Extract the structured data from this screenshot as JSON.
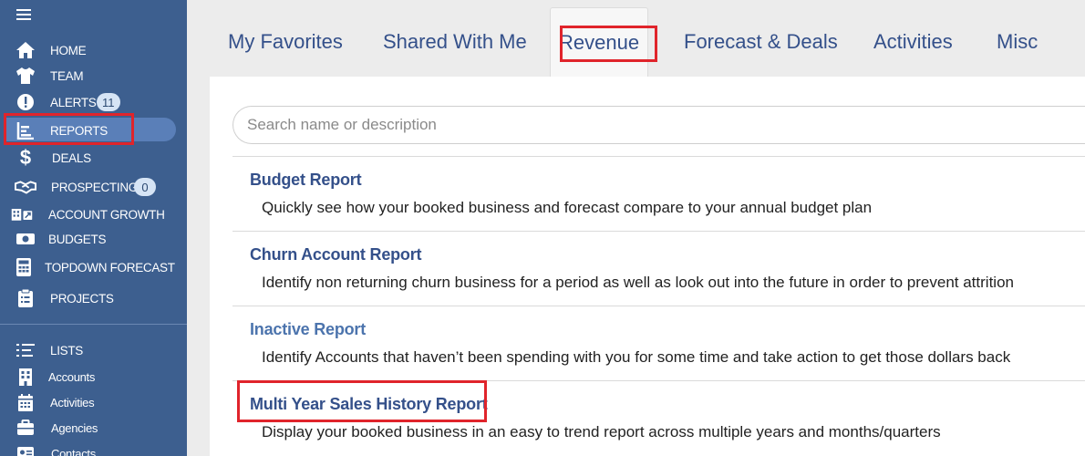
{
  "sidebar": {
    "menu_icon": "hamburger-icon",
    "items": [
      {
        "label": "HOME",
        "icon": "home-icon"
      },
      {
        "label": "TEAM",
        "icon": "shirt-icon"
      },
      {
        "label": "ALERTS",
        "icon": "alert-icon",
        "badge": "11"
      },
      {
        "label": "REPORTS",
        "icon": "chart-icon",
        "active": true
      },
      {
        "label": "DEALS",
        "icon": "dollar-icon"
      },
      {
        "label": "PROSPECTING",
        "icon": "handshake-icon",
        "badge": "0"
      },
      {
        "label": "ACCOUNT GROWTH",
        "icon": "building-icon"
      },
      {
        "label": "BUDGETS",
        "icon": "money-icon"
      },
      {
        "label": "TOPDOWN FORECAST",
        "icon": "calculator-icon"
      },
      {
        "label": "PROJECTS",
        "icon": "clipboard-icon"
      }
    ],
    "lists": [
      {
        "label": "LISTS",
        "icon": "list-icon"
      },
      {
        "label": "Accounts",
        "icon": "building-icon"
      },
      {
        "label": "Activities",
        "icon": "calendar-icon"
      },
      {
        "label": "Agencies",
        "icon": "briefcase-icon"
      },
      {
        "label": "Contacts",
        "icon": "id-card-icon"
      }
    ]
  },
  "tabs": [
    {
      "label": "My Favorites"
    },
    {
      "label": "Shared With Me"
    },
    {
      "label": "Revenue",
      "active": true
    },
    {
      "label": "Forecast & Deals"
    },
    {
      "label": "Activities"
    },
    {
      "label": "Misc"
    }
  ],
  "search": {
    "placeholder": "Search name or description"
  },
  "reports": [
    {
      "title": "Budget Report",
      "desc": "Quickly see how your booked business and forecast compare to your annual budget plan"
    },
    {
      "title": "Churn Account Report",
      "desc": "Identify non returning churn business for a period as well as look out into the future in order to prevent attrition"
    },
    {
      "title": "Inactive Report",
      "desc": "Identify Accounts that haven’t been spending with you for some time and take action to get those dollars back"
    },
    {
      "title": "Multi Year Sales History Report",
      "desc": "Display your booked business in an easy to trend report across multiple years and months/quarters"
    }
  ],
  "colors": {
    "sidebar": "#3d5f8f",
    "active_item": "#5a7fb8",
    "highlight": "#e0242b",
    "link": "#34508a"
  }
}
